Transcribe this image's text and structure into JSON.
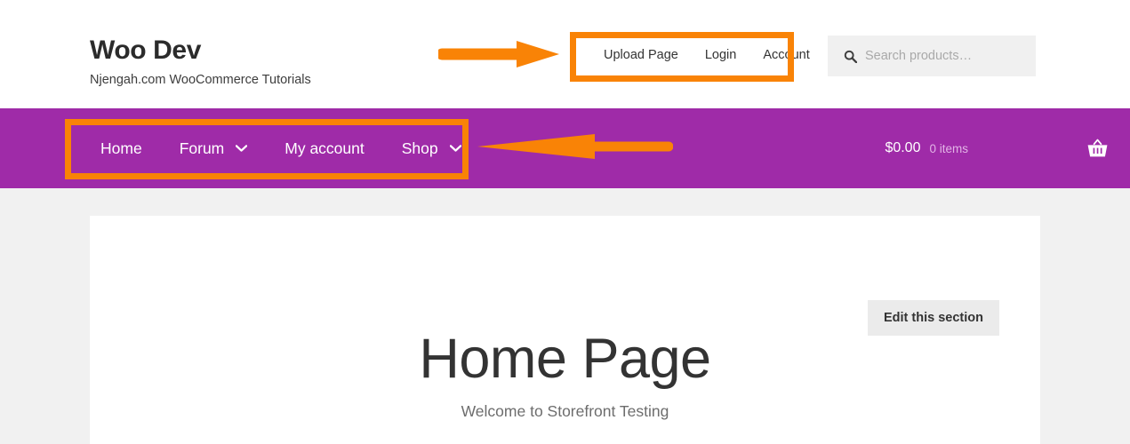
{
  "header": {
    "site_title": "Woo Dev",
    "tagline": "Njengah.com WooCommerce Tutorials",
    "secondary_nav": [
      {
        "label": "Upload Page",
        "name": "secondary-nav-item-upload-page"
      },
      {
        "label": "Login",
        "name": "secondary-nav-item-login"
      },
      {
        "label": "Account",
        "name": "secondary-nav-item-account"
      }
    ],
    "search": {
      "placeholder": "Search products…",
      "value": "",
      "icon": "search-icon"
    }
  },
  "nav_bar": {
    "background_color": "#9f2ba8",
    "items": [
      {
        "label": "Home",
        "has_dropdown": false
      },
      {
        "label": "Forum",
        "has_dropdown": true
      },
      {
        "label": "My account",
        "has_dropdown": false
      },
      {
        "label": "Shop",
        "has_dropdown": true
      }
    ],
    "cart": {
      "total": "$0.00",
      "items_count": "0 items",
      "icon": "shopping-basket-icon"
    }
  },
  "main": {
    "edit_section_label": "Edit this section",
    "page_title": "Home Page",
    "subtitle": "Welcome to Storefront Testing"
  },
  "annotations": {
    "color": "#f98306",
    "highlight_boxes": [
      {
        "target": "secondary-nav"
      },
      {
        "target": "main-nav"
      }
    ],
    "arrows": [
      {
        "direction": "right",
        "points_to": "secondary-nav-highlight"
      },
      {
        "direction": "left",
        "points_to": "main-nav-highlight"
      }
    ]
  }
}
